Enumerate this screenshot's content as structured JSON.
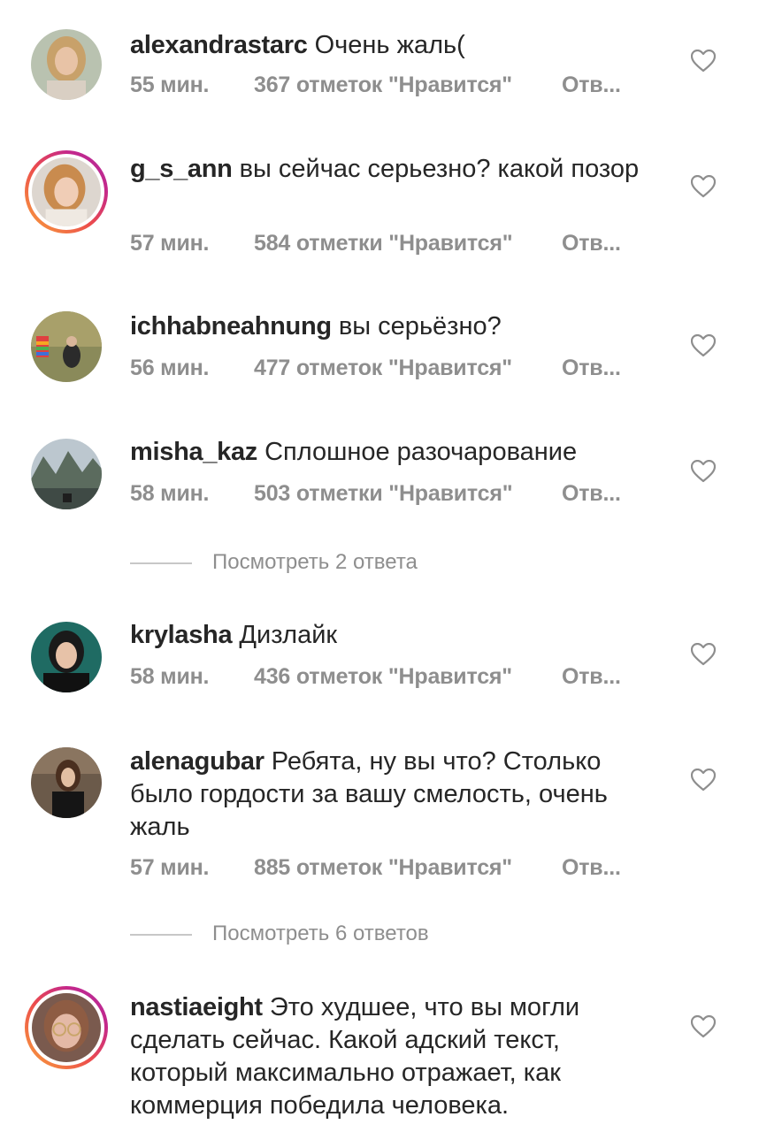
{
  "comments": [
    {
      "username": "alexandrastarc",
      "text": "Очень жаль(",
      "time": "55 мин.",
      "likes": "367 отметок \"Нравится\"",
      "reply": "Отв..."
    },
    {
      "username": "g_s_ann",
      "text": "вы сейчас серьезно? какой позор",
      "time": "57 мин.",
      "likes": "584 отметки \"Нравится\"",
      "reply": "Отв..."
    },
    {
      "username": "ichhabneahnung",
      "text": "вы серьёзно?",
      "time": "56 мин.",
      "likes": "477 отметок \"Нравится\"",
      "reply": "Отв..."
    },
    {
      "username": "misha_kaz",
      "text": "Сплошное разочарование",
      "time": "58 мин.",
      "likes": "503 отметки \"Нравится\"",
      "reply": "Отв..."
    },
    {
      "username": "krylasha",
      "text": "Дизлайк",
      "time": "58 мин.",
      "likes": "436 отметок \"Нравится\"",
      "reply": "Отв..."
    },
    {
      "username": "alenagubar",
      "text": "Ребята, ну вы что? Столько было гордости за вашу смелость, очень жаль",
      "time": "57 мин.",
      "likes": "885 отметок \"Нравится\"",
      "reply": "Отв..."
    },
    {
      "username": "nastiaeight",
      "text": "Это худшее, что вы могли сделать сейчас. Какой адский текст, который максимально отражает, как коммерция победила человека."
    }
  ],
  "view_replies": [
    "Посмотреть 2 ответа",
    "Посмотреть 6 ответов"
  ],
  "icons": {
    "like": "heart-outline-icon"
  },
  "colors": {
    "text": "#262626",
    "secondary": "#8e8e8e",
    "story_ring_start": "#f9a33a",
    "story_ring_end": "#b02ca0"
  }
}
